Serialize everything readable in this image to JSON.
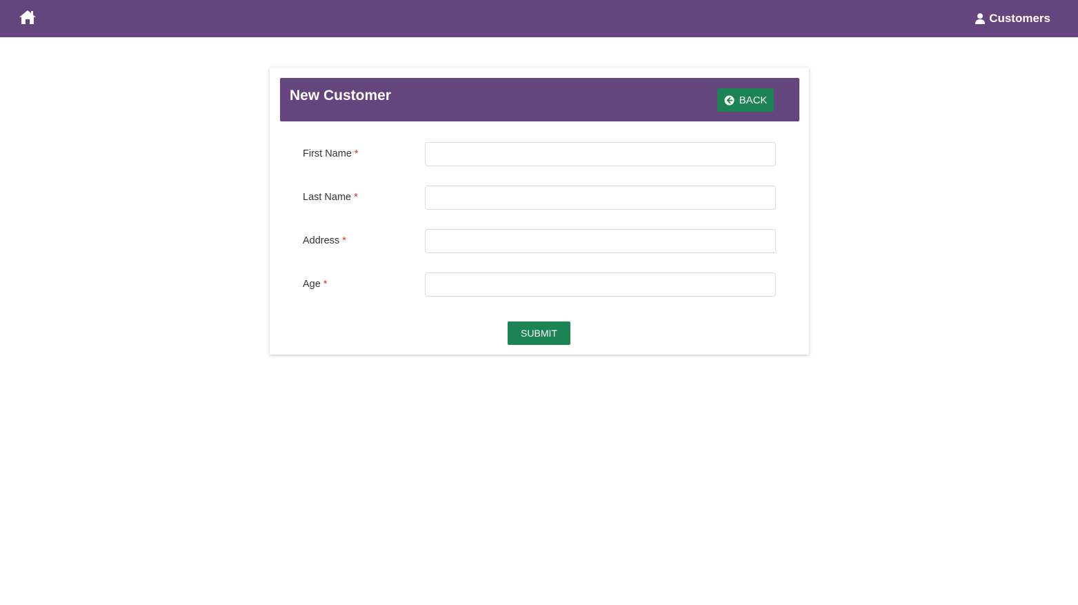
{
  "topbar": {
    "home_icon": "home-icon",
    "nav_label": "Customers",
    "nav_icon": "user-icon",
    "color": "#65457d"
  },
  "card": {
    "title": "New Customer",
    "back_label": "BACK",
    "back_icon": "arrow-circle-left-icon",
    "header_color": "#65457d",
    "button_color": "#1c8454"
  },
  "form": {
    "fields": [
      {
        "label": "First Name",
        "required": "*",
        "value": "",
        "placeholder": ""
      },
      {
        "label": "Last Name",
        "required": "*",
        "value": "",
        "placeholder": ""
      },
      {
        "label": "Address",
        "required": "*",
        "value": "",
        "placeholder": ""
      },
      {
        "label": "Age",
        "required": "*",
        "value": "",
        "placeholder": ""
      }
    ],
    "submit_label": "SUBMIT"
  }
}
